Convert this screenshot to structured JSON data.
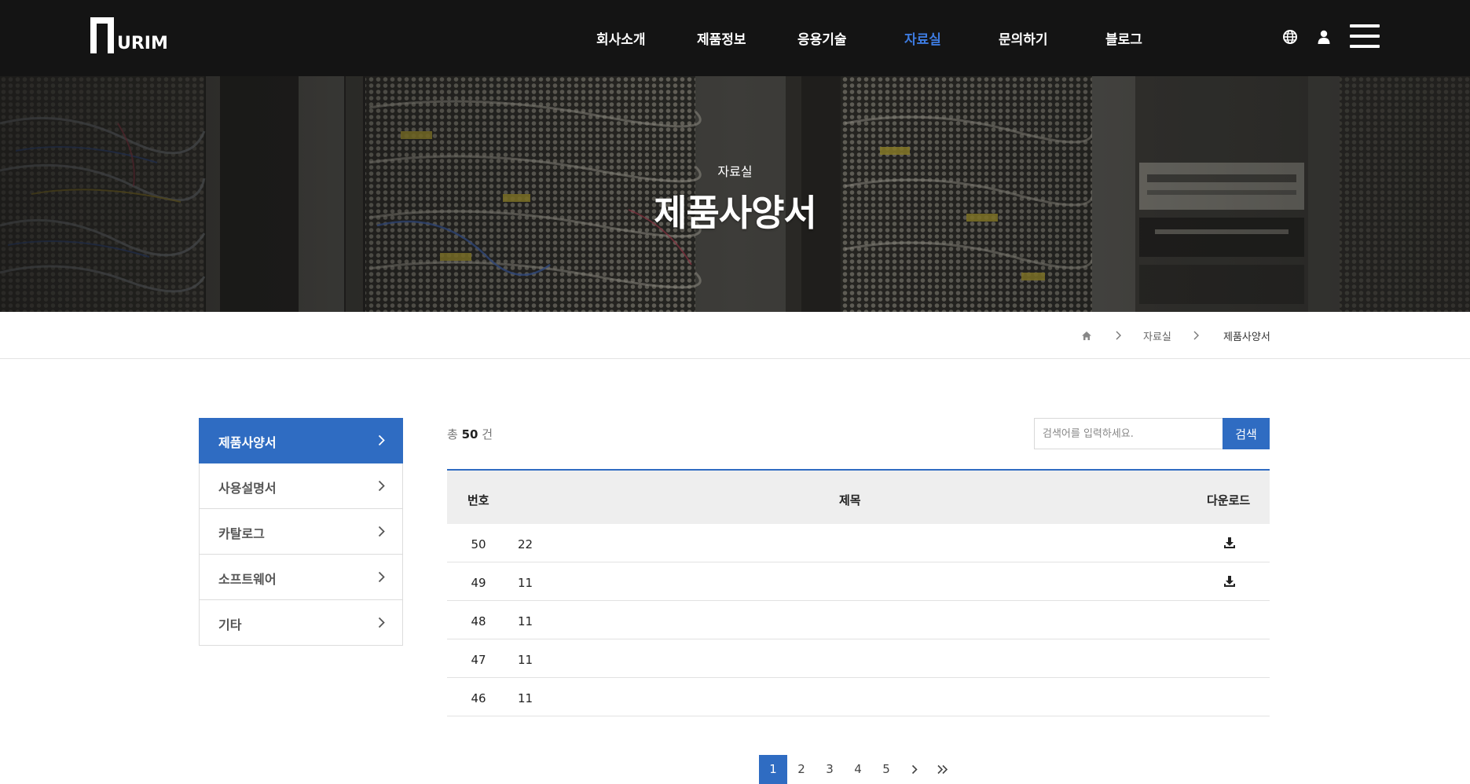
{
  "header": {
    "logo_text": "URIM",
    "nav": [
      {
        "label": "회사소개",
        "active": false
      },
      {
        "label": "제품정보",
        "active": false
      },
      {
        "label": "응용기술",
        "active": false
      },
      {
        "label": "자료실",
        "active": true
      },
      {
        "label": "문의하기",
        "active": false
      },
      {
        "label": "블로그",
        "active": false
      }
    ],
    "icons": [
      "globe-icon",
      "user-icon",
      "menu-icon"
    ],
    "accent_color": "#3d7be0"
  },
  "hero": {
    "subtitle": "자료실",
    "title": "제품사양서"
  },
  "breadcrumb": {
    "home_icon": "home-icon",
    "items": [
      "자료실",
      "제품사양서"
    ]
  },
  "sidebar": {
    "items": [
      {
        "label": "제품사양서",
        "active": true
      },
      {
        "label": "사용설명서",
        "active": false
      },
      {
        "label": "카탈로그",
        "active": false
      },
      {
        "label": "소프트웨어",
        "active": false
      },
      {
        "label": "기타",
        "active": false
      }
    ],
    "active_color": "#2f6cc2"
  },
  "list": {
    "total_prefix": "총",
    "total": "50",
    "total_suffix": "건",
    "search_placeholder": "검색어를 입력하세요.",
    "search_button": "검색",
    "columns": {
      "num": "번호",
      "title": "제목",
      "download": "다운로드"
    },
    "rows": [
      {
        "num": "50",
        "title": "22",
        "download": true
      },
      {
        "num": "49",
        "title": "11",
        "download": true
      },
      {
        "num": "48",
        "title": "11",
        "download": false
      },
      {
        "num": "47",
        "title": "11",
        "download": false
      },
      {
        "num": "46",
        "title": "11",
        "download": false
      }
    ]
  },
  "pagination": {
    "pages": [
      "1",
      "2",
      "3",
      "4",
      "5"
    ],
    "current": "1",
    "next_icon": "chevron-right-icon",
    "last_icon": "double-chevron-right-icon"
  }
}
